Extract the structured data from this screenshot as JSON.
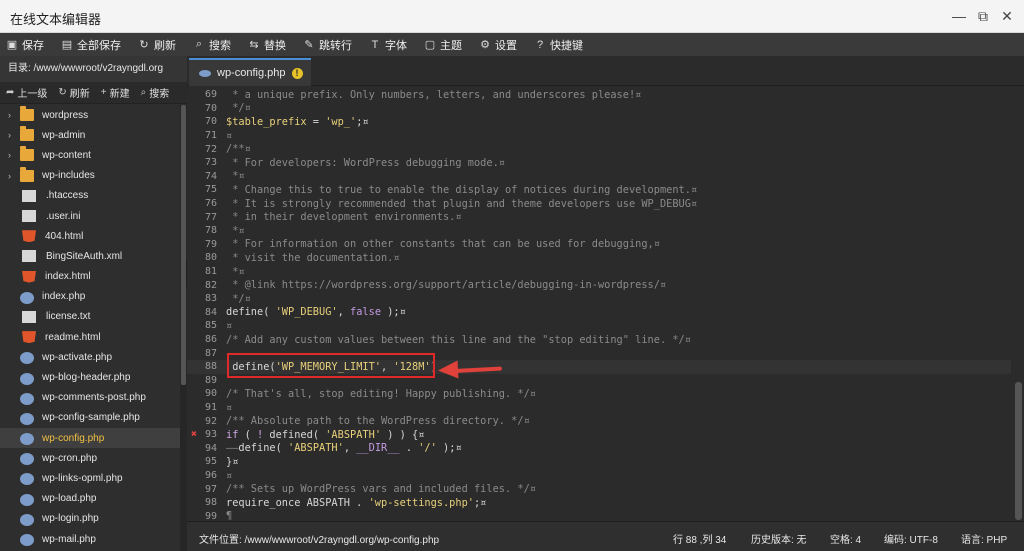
{
  "window": {
    "title": "在线文本编辑器"
  },
  "toolbar": {
    "items": [
      {
        "icon": "save-icon",
        "label": "保存"
      },
      {
        "icon": "save-all-icon",
        "label": "全部保存"
      },
      {
        "icon": "refresh-icon",
        "label": "刷新"
      },
      {
        "icon": "search-icon",
        "label": "搜索"
      },
      {
        "icon": "replace-icon",
        "label": "替换"
      },
      {
        "icon": "goto-line-icon",
        "label": "跳转行"
      },
      {
        "icon": "font-icon",
        "label": "字体"
      },
      {
        "icon": "theme-icon",
        "label": "主题"
      },
      {
        "icon": "gear-icon",
        "label": "设置"
      },
      {
        "icon": "help-icon",
        "label": "快捷键"
      }
    ]
  },
  "sidebar": {
    "directory": "目录: /www/wwwroot/v2rayngdl.org",
    "actions": [
      {
        "icon": "up-arrow-icon",
        "label": "上一级"
      },
      {
        "icon": "refresh-icon",
        "label": "刷新"
      },
      {
        "icon": "plus-icon",
        "label": "新建"
      },
      {
        "icon": "search-icon",
        "label": "搜索"
      }
    ],
    "files": [
      {
        "name": "wordpress",
        "type": "folder"
      },
      {
        "name": "wp-admin",
        "type": "folder"
      },
      {
        "name": "wp-content",
        "type": "folder"
      },
      {
        "name": "wp-includes",
        "type": "folder"
      },
      {
        "name": ".htaccess",
        "type": "file"
      },
      {
        "name": ".user.ini",
        "type": "file"
      },
      {
        "name": "404.html",
        "type": "html"
      },
      {
        "name": "BingSiteAuth.xml",
        "type": "file"
      },
      {
        "name": "index.html",
        "type": "html"
      },
      {
        "name": "index.php",
        "type": "php"
      },
      {
        "name": "license.txt",
        "type": "file"
      },
      {
        "name": "readme.html",
        "type": "html"
      },
      {
        "name": "wp-activate.php",
        "type": "php"
      },
      {
        "name": "wp-blog-header.php",
        "type": "php"
      },
      {
        "name": "wp-comments-post.php",
        "type": "php"
      },
      {
        "name": "wp-config-sample.php",
        "type": "php"
      },
      {
        "name": "wp-config.php",
        "type": "php",
        "active": true
      },
      {
        "name": "wp-cron.php",
        "type": "php"
      },
      {
        "name": "wp-links-opml.php",
        "type": "php"
      },
      {
        "name": "wp-load.php",
        "type": "php"
      },
      {
        "name": "wp-login.php",
        "type": "php"
      },
      {
        "name": "wp-mail.php",
        "type": "php"
      }
    ]
  },
  "editor": {
    "tab": {
      "label": "wp-config.php",
      "modified_mark": "!"
    },
    "lines": [
      {
        "n": "69",
        "parts": [
          [
            "cm",
            " * a unique prefix. Only numbers, letters, and underscores please!¤"
          ]
        ]
      },
      {
        "n": "70",
        "parts": [
          [
            "cm",
            " */¤"
          ]
        ]
      },
      {
        "n": "70",
        "parts": [
          [
            "va",
            "$table_prefix"
          ],
          [
            "fn",
            " = "
          ],
          [
            "st",
            "'wp_'"
          ],
          [
            "fn",
            ";¤"
          ]
        ]
      },
      {
        "n": "71",
        "parts": [
          [
            "cm",
            "¤"
          ]
        ]
      },
      {
        "n": "72",
        "parts": [
          [
            "cm",
            "/**¤"
          ]
        ]
      },
      {
        "n": "73",
        "parts": [
          [
            "cm",
            " * For developers: WordPress debugging mode.¤"
          ]
        ]
      },
      {
        "n": "74",
        "parts": [
          [
            "cm",
            " *¤"
          ]
        ]
      },
      {
        "n": "75",
        "parts": [
          [
            "cm",
            " * Change this to true to enable the display of notices during development.¤"
          ]
        ]
      },
      {
        "n": "76",
        "parts": [
          [
            "cm",
            " * It is strongly recommended that plugin and theme developers use WP_DEBUG¤"
          ]
        ]
      },
      {
        "n": "77",
        "parts": [
          [
            "cm",
            " * in their development environments.¤"
          ]
        ]
      },
      {
        "n": "78",
        "parts": [
          [
            "cm",
            " *¤"
          ]
        ]
      },
      {
        "n": "79",
        "parts": [
          [
            "cm",
            " * For information on other constants that can be used for debugging,¤"
          ]
        ]
      },
      {
        "n": "80",
        "parts": [
          [
            "cm",
            " * visit the documentation.¤"
          ]
        ]
      },
      {
        "n": "81",
        "parts": [
          [
            "cm",
            " *¤"
          ]
        ]
      },
      {
        "n": "82",
        "parts": [
          [
            "cm",
            " * @link https://wordpress.org/support/article/debugging-in-wordpress/¤"
          ]
        ]
      },
      {
        "n": "83",
        "parts": [
          [
            "cm",
            " */¤"
          ]
        ]
      },
      {
        "n": "84",
        "parts": [
          [
            "fn",
            "define( "
          ],
          [
            "st",
            "'WP_DEBUG'"
          ],
          [
            "fn",
            ", "
          ],
          [
            "bl",
            "false"
          ],
          [
            "fn",
            " );¤"
          ]
        ]
      },
      {
        "n": "85",
        "parts": [
          [
            "cm",
            "¤"
          ]
        ]
      },
      {
        "n": "86",
        "parts": [
          [
            "cm",
            "/* Add any custom values between this line and the \"stop editing\" line. */¤"
          ]
        ]
      },
      {
        "n": "87",
        "parts": [
          [
            "cm",
            ""
          ]
        ]
      },
      {
        "n": "88",
        "parts": [
          [
            "fn",
            " define("
          ],
          [
            "st",
            "'WP_MEMORY_LIMIT'"
          ],
          [
            "fn",
            ", "
          ],
          [
            "st",
            "'128M'"
          ],
          [
            "fn",
            ")"
          ]
        ],
        "current": true
      },
      {
        "n": "89",
        "parts": [
          [
            "cm",
            ""
          ]
        ]
      },
      {
        "n": "90",
        "parts": [
          [
            "cm",
            "/* That's all, stop editing! Happy publishing. */¤"
          ]
        ]
      },
      {
        "n": "91",
        "parts": [
          [
            "cm",
            "¤"
          ]
        ]
      },
      {
        "n": "92",
        "parts": [
          [
            "cm",
            "/** Absolute path to the WordPress directory. */¤"
          ]
        ]
      },
      {
        "n": "93",
        "parts": [
          [
            "kw",
            "if"
          ],
          [
            "fn",
            " ( "
          ],
          [
            "kw",
            "!"
          ],
          [
            "fn",
            " defined( "
          ],
          [
            "st",
            "'ABSPATH'"
          ],
          [
            "fn",
            " ) ) {¤"
          ]
        ],
        "error": "✖"
      },
      {
        "n": "94",
        "parts": [
          [
            "cm",
            "——"
          ],
          [
            "fn",
            "define( "
          ],
          [
            "st",
            "'ABSPATH'"
          ],
          [
            "fn",
            ", "
          ],
          [
            "bl",
            "__DIR__"
          ],
          [
            "fn",
            " . "
          ],
          [
            "st",
            "'/'"
          ],
          [
            "fn",
            " );¤"
          ]
        ]
      },
      {
        "n": "95",
        "parts": [
          [
            "fn",
            "}¤"
          ]
        ]
      },
      {
        "n": "96",
        "parts": [
          [
            "cm",
            "¤"
          ]
        ]
      },
      {
        "n": "97",
        "parts": [
          [
            "cm",
            "/** Sets up WordPress vars and included files. */¤"
          ]
        ]
      },
      {
        "n": "98",
        "parts": [
          [
            "fn",
            "require_once ABSPATH . "
          ],
          [
            "st",
            "'wp-settings.php'"
          ],
          [
            "fn",
            ";¤"
          ]
        ]
      },
      {
        "n": "99",
        "parts": [
          [
            "cm",
            "¶"
          ]
        ]
      }
    ]
  },
  "status": {
    "path": "文件位置: /www/wwwroot/v2rayngdl.org/wp-config.php",
    "position": "行 88 ,列 34",
    "history": "历史版本: 无",
    "indent": "空格: 4",
    "encoding": "编码: UTF-8",
    "language": "语言: PHP"
  }
}
